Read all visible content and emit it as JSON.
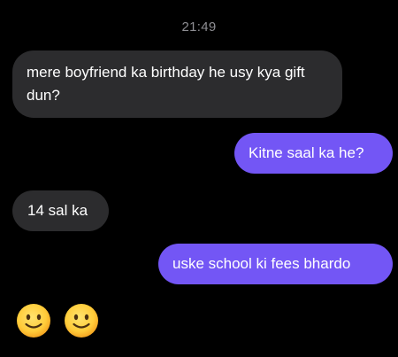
{
  "chat": {
    "timestamp": "21:49",
    "messages": [
      {
        "from": "them",
        "text": "mere boyfriend ka birthday he usy kya gift dun?"
      },
      {
        "from": "me",
        "text": "Kitne saal ka he?"
      },
      {
        "from": "them",
        "text": "14 sal ka"
      },
      {
        "from": "me",
        "text": "uske school ki fees bhardo"
      }
    ],
    "reactions": [
      "slightly-smiling-face-icon",
      "slightly-smiling-face-icon"
    ]
  },
  "colors": {
    "background": "#000000",
    "incoming_bubble": "#2c2c2e",
    "outgoing_bubble": "#7356f5",
    "timestamp_text": "#8e8e93",
    "message_text": "#ffffff"
  }
}
